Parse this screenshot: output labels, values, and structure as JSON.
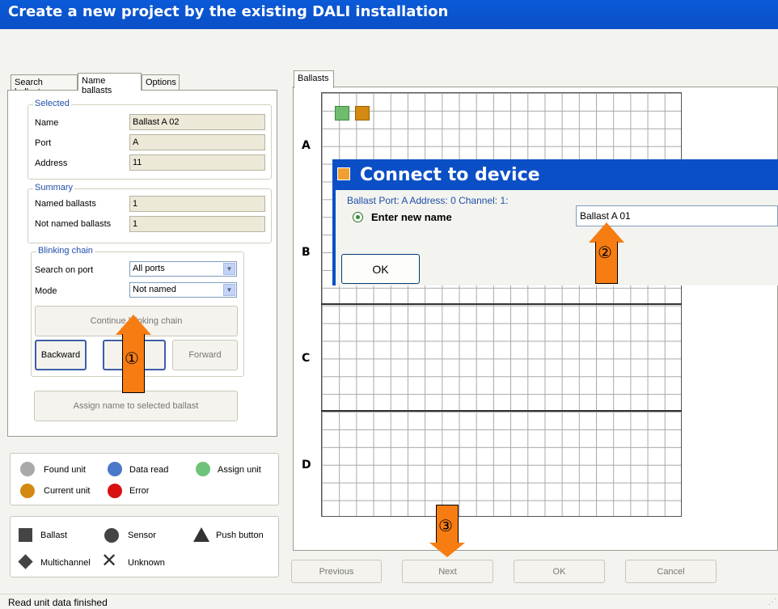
{
  "window": {
    "title": "Create a new project by the existing DALI installation"
  },
  "left_tabs": [
    "Search ballasts",
    "Name ballasts",
    "Options"
  ],
  "selected": {
    "title": "Selected",
    "name_label": "Name",
    "name_value": "Ballast A 02",
    "port_label": "Port",
    "port_value": "A",
    "address_label": "Address",
    "address_value": "11"
  },
  "summary": {
    "title": "Summary",
    "named_label": "Named ballasts",
    "named_value": "1",
    "not_named_label": "Not named ballasts",
    "not_named_value": "1"
  },
  "blinking": {
    "title": "Blinking chain",
    "search_label": "Search on port",
    "search_value": "All ports",
    "mode_label": "Mode",
    "mode_value": "Not named",
    "continue_label": "Continue blinking chain",
    "backward_label": "Backward",
    "forward_label": "Forward",
    "assign_label": "Assign name to selected ballast"
  },
  "legend_status": [
    {
      "label": "Found unit",
      "color": "#a9a9a9"
    },
    {
      "label": "Data read",
      "color": "#4a78c8"
    },
    {
      "label": "Assign unit",
      "color": "#6fc27a"
    },
    {
      "label": "Current unit",
      "color": "#d38a12"
    },
    {
      "label": "Error",
      "color": "#d81010"
    }
  ],
  "legend_types": [
    "Ballast",
    "Sensor",
    "Push button",
    "Multichannel",
    "Unknown"
  ],
  "right_tab": "Ballasts",
  "rows": [
    "A",
    "B",
    "C",
    "D"
  ],
  "dialog": {
    "title": "Connect to device",
    "subtitle": "Ballast  Port: A  Address: 0  Channel: 1:",
    "option_label": "Enter new name",
    "name_value": "Ballast A 01",
    "ok_label": "OK"
  },
  "nav": {
    "previous": "Previous",
    "next": "Next",
    "ok": "OK",
    "cancel": "Cancel"
  },
  "annotations": [
    "①",
    "②",
    "③"
  ],
  "status": "Read unit data finished"
}
